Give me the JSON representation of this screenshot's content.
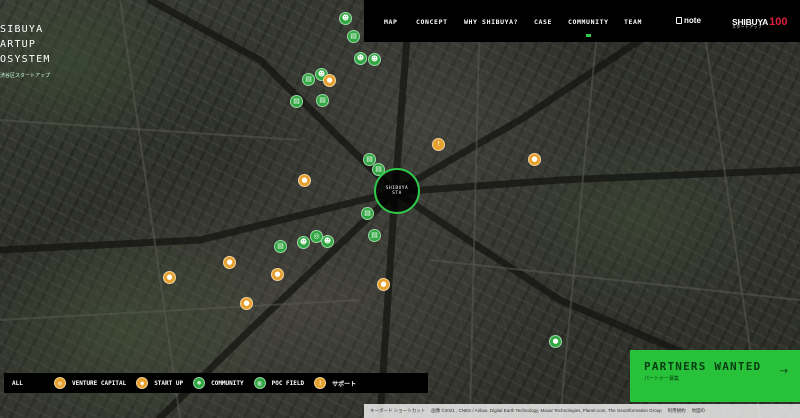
{
  "logo": {
    "lines": [
      "SIBUYA",
      "ARTUP",
      "OSYSTEM"
    ],
    "subtitle": "渋谷区スタートアップ"
  },
  "nav": {
    "items": [
      {
        "label": "MAP"
      },
      {
        "label": "CONCEPT"
      },
      {
        "label": "WHY SHIBUYA?"
      },
      {
        "label": "CASE"
      },
      {
        "label": "COMMUNITY"
      },
      {
        "label": "TEAM"
      }
    ],
    "active_item": "COMMUNITY",
    "note_label": "note",
    "brand_text": "SHIBUYA",
    "brand_number": "100",
    "brand_sub": "スタートアップ"
  },
  "map": {
    "station_line1": "SHIBUYA",
    "station_line2": "STA"
  },
  "partners": {
    "title": "PARTNERS WANTED",
    "subtitle": "パートナー募集",
    "arrow": "→"
  },
  "legend": {
    "all_label": "ALL",
    "items": [
      {
        "label": "VENTURE CAPITAL",
        "icon": "globe-icon",
        "color": "#e5a02d"
      },
      {
        "label": "START UP",
        "icon": "pin-icon",
        "color": "#e5a02d"
      },
      {
        "label": "COMMUNITY",
        "icon": "people-icon",
        "color": "#2fa640"
      },
      {
        "label": "POC FIELD",
        "icon": "document-icon",
        "color": "#2fa640"
      },
      {
        "label": "サポート",
        "icon": "info-icon",
        "color": "#e5a02d"
      }
    ]
  },
  "attribution": {
    "shortcuts": "キーボード ショートカット",
    "imagery": "画像 ©2021 , CNES / Airbus, Digital Earth Technology, Maxar Technologies, Planet.com, The GeoInformation Group",
    "terms": "利用規約",
    "report": "地図の"
  },
  "colors": {
    "accent_green": "#2fa640",
    "banner_green": "#27c23a",
    "marker_orange": "#e5a02d",
    "brand_red": "#e0203a"
  }
}
